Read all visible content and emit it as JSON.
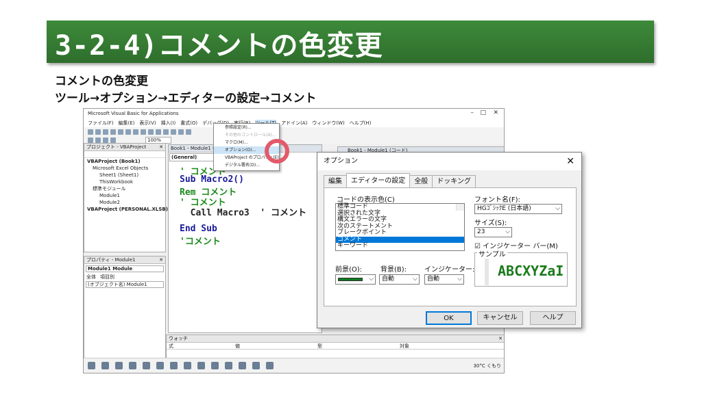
{
  "banner": {
    "title": "3-2-4)コメントの色変更"
  },
  "subtitle": {
    "line1": "コメントの色変更",
    "line2": "ツール→オプション→エディターの設定→コメント"
  },
  "vbe": {
    "title": "Microsoft Visual Basic for Applications",
    "menu": [
      "ファイル(F)",
      "編集(E)",
      "表示(V)",
      "挿入(I)",
      "書式(O)",
      "デバッグ(D)",
      "実行(R)",
      "ツール(T)",
      "アドイン(A)",
      "ウィンドウ(W)",
      "ヘルプ(H)"
    ],
    "zoom": "100%",
    "project_pane": {
      "title": "プロジェクト - VBAProject",
      "tree": [
        "VBAProject (Book1)",
        "Microsoft Excel Objects",
        "Sheet1 (Sheet1)",
        "ThisWorkbook",
        "標準モジュール",
        "Module1",
        "Module2",
        "VBAProject (PERSONAL.XLSB)"
      ]
    },
    "props_pane": {
      "title": "プロパティ - Module1",
      "object": "Module1 Module",
      "tab_all": "全体",
      "tab_cat": "項目別",
      "row": "(オブジェクト名) Module1"
    },
    "code_pane": {
      "title": "Book1 - Module1 (コード)",
      "object_combo": "(General)",
      "lines": [
        "' コメント",
        "Sub Macro2()",
        "Rem コメント",
        "' コメント",
        "  Call Macro3  ' コメント",
        "End Sub",
        "'コメント"
      ]
    },
    "second_code_title": "Book1 - Module1 (コード)",
    "watch_pane": {
      "title": "ウォッチ",
      "cols": [
        "式",
        "値",
        "型",
        "対象"
      ]
    },
    "taskbar": {
      "weather": "30°C くもり"
    },
    "tools_menu": [
      "参照設定(R)...",
      "その他のコントロール(A)...",
      "マクロ(M)...",
      "オプション(O)...",
      "VBAProject のプロパティ(E)...",
      "デジタル署名(D)..."
    ]
  },
  "dialog": {
    "title": "オプション",
    "close": "✕",
    "tabs": [
      "編集",
      "エディターの設定",
      "全般",
      "ドッキング"
    ],
    "code_colors_label": "コードの表示色(C)",
    "code_colors": [
      "標準コード",
      "選択された文字",
      "構文エラーの文字",
      "次のステートメント",
      "ブレークポイント",
      "コメント",
      "キーワード"
    ],
    "selected_color": "コメント",
    "font_label": "フォント名(F):",
    "font_value": "HGｺﾞｼｯｸE (日本語)",
    "size_label": "サイズ(S):",
    "size_value": "23",
    "indicator_label": "インジケーター バー(M)",
    "sample_label": "サンプル",
    "sample_text": "ABCXYZaI",
    "fore_label": "前景(O):",
    "back_label": "背景(B):",
    "ind_label": "インジケーター:",
    "back_value": "自動",
    "ind_value": "自動",
    "fore_color": "#0f7a1f",
    "ok": "OK",
    "cancel": "キャンセル",
    "help": "ヘルプ"
  },
  "colors": {
    "banner": "#2e6e2c",
    "comment": "#1a8a1a",
    "highlight_ring": "#e35a6a"
  }
}
